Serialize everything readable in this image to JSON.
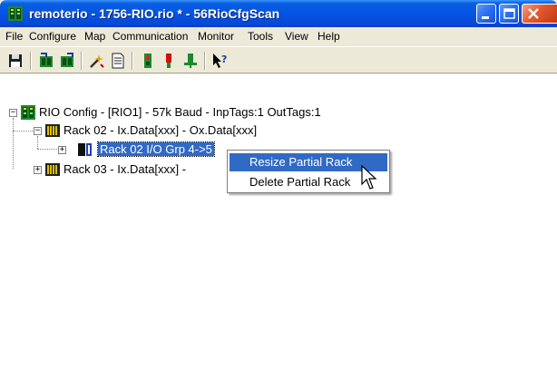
{
  "window": {
    "title": "remoterio - 1756-RIO.rio * - 56RioCfgScan"
  },
  "menu": [
    "File",
    "Configure",
    "Map",
    "Communication",
    "Monitor",
    "Tools",
    "View",
    "Help"
  ],
  "toolbar": {
    "icons": [
      "save-icon",
      "upload-icon",
      "download-icon",
      "tools-wizard-icon",
      "document-icon",
      "connect-icon",
      "run-icon",
      "disconnect-icon",
      "help-cursor-icon"
    ]
  },
  "tree": {
    "root": "RIO Config - [RIO1] -  57k Baud - InpTags:1 OutTags:1",
    "rack02": "Rack 02 - Ix.Data[xxx] - Ox.Data[xxx]",
    "rack02_group": "Rack 02 I/O Grp 4->5",
    "rack03": "Rack 03 - Ix.Data[xxx] -"
  },
  "context_menu": {
    "items": [
      "Resize Partial Rack",
      "Delete Partial Rack"
    ],
    "highlighted_index": 0
  },
  "colors": {
    "titlebar": "#0554e3",
    "selection": "#316ac5",
    "close_button": "#e2572d"
  }
}
